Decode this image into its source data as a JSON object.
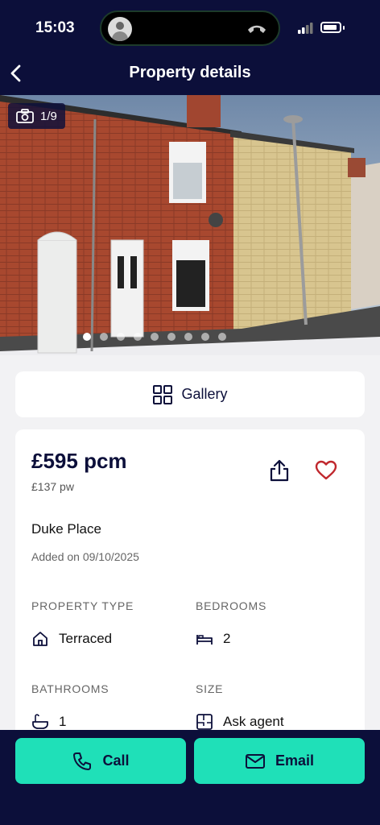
{
  "status_bar": {
    "time": "15:03"
  },
  "nav": {
    "title": "Property details"
  },
  "hero": {
    "photo_counter": "1/9",
    "photo_total": 9,
    "active_photo_index": 0
  },
  "gallery": {
    "label": "Gallery"
  },
  "listing": {
    "price": "£595 pcm",
    "price_weekly": "£137 pw",
    "address": "Duke Place",
    "added": "Added on 09/10/2025"
  },
  "specs": {
    "property_type": {
      "label": "PROPERTY TYPE",
      "value": "Terraced",
      "icon": "house-icon"
    },
    "bedrooms": {
      "label": "BEDROOMS",
      "value": "2",
      "icon": "bed-icon"
    },
    "bathrooms": {
      "label": "BATHROOMS",
      "value": "1",
      "icon": "bath-icon"
    },
    "size": {
      "label": "SIZE",
      "value": "Ask agent",
      "icon": "floorplan-icon"
    }
  },
  "actions": {
    "call": "Call",
    "email": "Email"
  },
  "colors": {
    "navy": "#0c0f3a",
    "accent": "#1fe0b8",
    "heart": "#c0272d"
  }
}
